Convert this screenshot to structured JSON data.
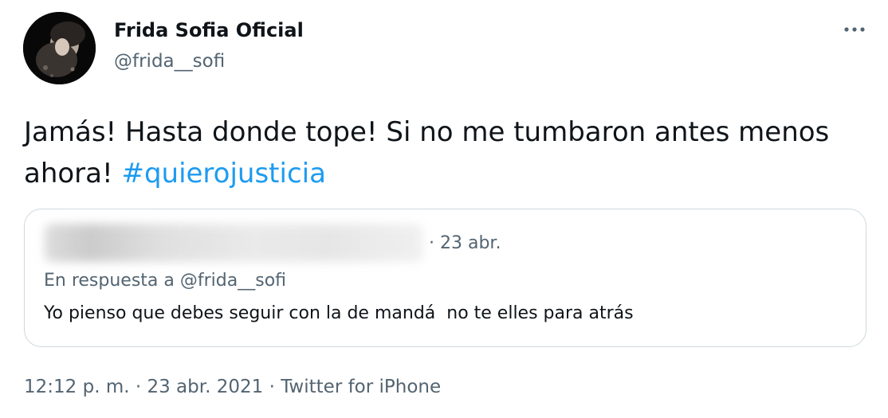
{
  "author": {
    "display_name": "Frida Sofia Oficial",
    "handle": "@frida__sofi"
  },
  "icons": {
    "avatar": "profile-photo",
    "more": "more-options-ellipsis-icon"
  },
  "tweet": {
    "text": "Jamás! Hasta donde tope! Si no me tumbaron antes menos ahora!",
    "hashtag": "#quierojusticia"
  },
  "quoted_tweet": {
    "date": "· 23 abr.",
    "reply_prefix": "En respuesta a",
    "reply_to": "@frida__sofi",
    "text": "Yo pienso que debes seguir con la de mandá  no te elles para atrás"
  },
  "meta": {
    "time": "12:12 p. m.",
    "separator": "·",
    "date": "23 abr. 2021",
    "source": "Twitter for iPhone"
  },
  "colors": {
    "text": "#0f1419",
    "secondary": "#536471",
    "accent": "#1d9bf0",
    "border": "#cfd9de"
  }
}
